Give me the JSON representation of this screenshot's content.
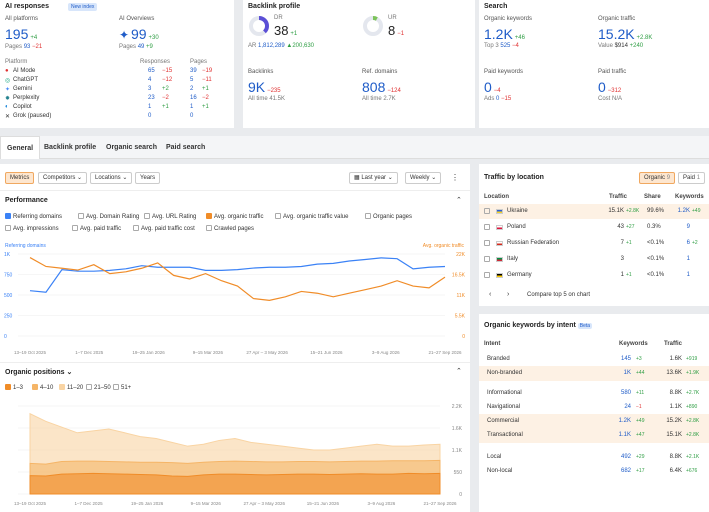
{
  "ai": {
    "title": "AI responses",
    "badge": "New index",
    "all_label": "All platforms",
    "all_value": "195",
    "all_delta": "+4",
    "pages_label": "Pages",
    "pages_value": "93",
    "pages_delta": "−21",
    "ov_label": "AI Overviews",
    "ov_value": "99",
    "ov_delta": "+30",
    "ov_pages_label": "Pages",
    "ov_pages_value": "49",
    "ov_pages_delta": "+9",
    "col_platform": "Platform",
    "col_resp": "Responses",
    "col_pages": "Pages",
    "rows": [
      {
        "name": "AI Mode",
        "r": "65",
        "rd": "−15",
        "p": "39",
        "pd": "−19"
      },
      {
        "name": "ChatGPT",
        "r": "4",
        "rd": "−12",
        "p": "5",
        "pd": "−11"
      },
      {
        "name": "Gemini",
        "r": "3",
        "rd": "+2",
        "p": "2",
        "pd": "+1"
      },
      {
        "name": "Perplexity",
        "r": "23",
        "rd": "−2",
        "p": "16",
        "pd": "−2"
      },
      {
        "name": "Copilot",
        "r": "1",
        "rd": "+1",
        "p": "1",
        "pd": "+1"
      },
      {
        "name": "Grok (paused)",
        "r": "0",
        "rd": "",
        "p": "0",
        "pd": ""
      }
    ]
  },
  "bl": {
    "title": "Backlink profile",
    "dr_label": "DR",
    "dr_value": "38",
    "dr_delta": "+1",
    "ur_label": "UR",
    "ur_value": "8",
    "ur_delta": "−1",
    "ar_label": "AR",
    "ar_value": "1,812,289",
    "ar_delta": "▲200,630",
    "bk_label": "Backlinks",
    "bk_value": "9K",
    "bk_delta": "−235",
    "bk_all": "All time 41.5K",
    "rd_label": "Ref. domains",
    "rd_value": "808",
    "rd_delta": "−124",
    "rd_all": "All time 2.7K"
  },
  "search": {
    "title": "Search",
    "ok_label": "Organic keywords",
    "ok_value": "1.2K",
    "ok_delta": "+46",
    "top3": "Top 3",
    "top3_v": "525",
    "top3_d": "−4",
    "ot_label": "Organic traffic",
    "ot_value": "15.2K",
    "ot_delta": "+2.8K",
    "val_label": "Value",
    "val_v": "$914",
    "val_d": "+240",
    "pk_label": "Paid keywords",
    "pk_value": "0",
    "pk_delta": "−4",
    "ads": "Ads",
    "ads_v": "0",
    "ads_d": "−15",
    "pt_label": "Paid traffic",
    "pt_value": "0",
    "pt_delta": "−312",
    "cost": "Cost N/A"
  },
  "tabs": [
    "General",
    "Backlink profile",
    "Organic search",
    "Paid search"
  ],
  "toolbar": {
    "b1": "Metrics",
    "b2": "Competitors",
    "b3": "Locations",
    "b4": "Years",
    "range": "Last year",
    "period": "Weekly"
  },
  "perf": {
    "title": "Performance",
    "checks": [
      {
        "l": "Referring domains",
        "on": true
      },
      {
        "l": "Avg. Domain Rating",
        "on": false
      },
      {
        "l": "Avg. URL Rating",
        "on": false
      },
      {
        "l": "Avg. organic traffic",
        "on": true
      },
      {
        "l": "Avg. organic traffic value",
        "on": false
      },
      {
        "l": "Organic pages",
        "on": false
      },
      {
        "l": "Avg. impressions",
        "on": false
      },
      {
        "l": "Avg. paid traffic",
        "on": false
      },
      {
        "l": "Avg. paid traffic cost",
        "on": false
      },
      {
        "l": "Crawled pages",
        "on": false
      }
    ],
    "left_axis_title": "Referring domains",
    "right_axis_title": "Avg. organic traffic"
  },
  "pos": {
    "title": "Organic positions",
    "checks": [
      {
        "l": "1–3",
        "on": true
      },
      {
        "l": "4–10",
        "on": true
      },
      {
        "l": "11–20",
        "on": true
      },
      {
        "l": "21–50",
        "on": false
      },
      {
        "l": "51+",
        "on": false
      }
    ]
  },
  "chart_data": [
    {
      "type": "line",
      "title": "Performance",
      "x": [
        "13–19 Oct 2025",
        "1–7 Dec 2025",
        "19–25 Jan 2026",
        "9–15 Mar 2026",
        "27 Apr – 3 May 2026",
        "15–21 Jun 2026",
        "3–9 Aug 2026",
        "21–27 Sep 2026"
      ],
      "yleft": {
        "ticks": [
          "0",
          "250",
          "500",
          "750",
          "1K"
        ],
        "range": [
          0,
          1050
        ]
      },
      "yright": {
        "ticks": [
          "0",
          "5.5K",
          "11K",
          "16.5K",
          "22K"
        ],
        "range": [
          0,
          23000
        ]
      },
      "series": [
        {
          "name": "Referring domains",
          "axis": "left",
          "color": "#3b82f6",
          "values": [
            580,
            560,
            850,
            830,
            830,
            840,
            860,
            900,
            880,
            880,
            880,
            840,
            840,
            850,
            870,
            880,
            880,
            890,
            920,
            930,
            960,
            980,
            1000,
            990,
            860,
            880,
            890
          ]
        },
        {
          "name": "Avg. organic traffic",
          "axis": "right",
          "color": "#f08c28",
          "values": [
            22000,
            19500,
            19000,
            18500,
            20000,
            17500,
            18000,
            19000,
            20500,
            17000,
            16000,
            17500,
            15500,
            14000,
            10500,
            10000,
            11000,
            12500,
            12000,
            11000,
            12000,
            13000,
            14000,
            15500,
            14000,
            13500,
            16500
          ]
        }
      ]
    },
    {
      "type": "area",
      "title": "Organic positions",
      "x": [
        "13–19 Oct 2025",
        "1–7 Dec 2025",
        "19–25 Jan 2026",
        "9–15 Mar 2026",
        "27 Apr – 3 May 2026",
        "15–21 Jun 2026",
        "3–9 Aug 2026",
        "21–27 Sep 2026"
      ],
      "yticks": [
        "0",
        "550",
        "1.1K",
        "1.6K",
        "2.2K"
      ],
      "range": [
        0,
        2300
      ],
      "series": [
        {
          "name": "1–3",
          "color": "#f08c28",
          "values": [
            480,
            470,
            520,
            530,
            540,
            530,
            520,
            510,
            500,
            470,
            460,
            500,
            520,
            520,
            510,
            500,
            510,
            520,
            520,
            510,
            520,
            530,
            520,
            520,
            540,
            530,
            540
          ]
        },
        {
          "name": "4–10",
          "color": "#f5b567",
          "values": [
            800,
            780,
            850,
            860,
            860,
            850,
            840,
            830,
            830,
            820,
            800,
            830,
            850,
            860,
            850,
            840,
            840,
            850,
            850,
            840,
            850,
            860,
            860,
            870,
            870,
            870,
            880
          ]
        },
        {
          "name": "11–20",
          "color": "#f9d4a3",
          "values": [
            2100,
            1900,
            1750,
            1600,
            1650,
            1700,
            1600,
            1500,
            1450,
            1350,
            1250,
            1300,
            1400,
            1450,
            1350,
            1300,
            1250,
            1200,
            1150,
            1150,
            1200,
            1250,
            1300,
            1250,
            1250,
            1280,
            1300
          ]
        }
      ]
    }
  ],
  "loc": {
    "title": "Traffic by location",
    "btn_org": "Organic",
    "btn_org_n": "9",
    "btn_paid": "Paid",
    "btn_paid_n": "1",
    "h_loc": "Location",
    "h_tr": "Traffic",
    "h_share": "Share",
    "h_kw": "Keywords",
    "rows": [
      {
        "name": "Ukraine",
        "tr": "15.1K",
        "trd": "+2.8K",
        "share": "99.6%",
        "kw": "1.2K",
        "kwd": "+49",
        "f1": "#2b5fd9",
        "f2": "#f5d327"
      },
      {
        "name": "Poland",
        "tr": "43",
        "trd": "+27",
        "share": "0.3%",
        "kw": "9",
        "kwd": "",
        "f1": "#ffffff",
        "f2": "#dc143c"
      },
      {
        "name": "Russian Federation",
        "tr": "7",
        "trd": "+1",
        "share": "<0.1%",
        "kw": "6",
        "kwd": "+2",
        "f1": "#ffffff",
        "f2": "#d52b1e"
      },
      {
        "name": "Italy",
        "tr": "3",
        "trd": "",
        "share": "<0.1%",
        "kw": "1",
        "kwd": "",
        "f1": "#009246",
        "f2": "#ce2b37"
      },
      {
        "name": "Germany",
        "tr": "1",
        "trd": "+1",
        "share": "<0.1%",
        "kw": "1",
        "kwd": "",
        "f1": "#000000",
        "f2": "#ffce00"
      }
    ],
    "compare": "Compare top 5 on chart"
  },
  "intent": {
    "title": "Organic keywords by intent",
    "badge": "Beta",
    "h_int": "Intent",
    "h_kw": "Keywords",
    "h_tr": "Traffic",
    "rows": [
      {
        "name": "Branded",
        "kw": "145",
        "kwd": "+3",
        "tr": "1.6K",
        "trd": "+919"
      },
      {
        "name": "Non-branded",
        "kw": "1K",
        "kwd": "+44",
        "tr": "13.6K",
        "trd": "+1.9K"
      },
      {
        "name": "Informational",
        "kw": "580",
        "kwd": "+11",
        "tr": "8.8K",
        "trd": "+2.7K"
      },
      {
        "name": "Navigational",
        "kw": "24",
        "kwd": "−1",
        "tr": "1.1K",
        "trd": "+890"
      },
      {
        "name": "Commercial",
        "kw": "1.2K",
        "kwd": "+49",
        "tr": "15.2K",
        "trd": "+2.8K"
      },
      {
        "name": "Transactional",
        "kw": "1.1K",
        "kwd": "+47",
        "tr": "15.1K",
        "trd": "+2.8K"
      },
      {
        "name": "Local",
        "kw": "492",
        "kwd": "+29",
        "tr": "8.8K",
        "trd": "+2.1K"
      },
      {
        "name": "Non-local",
        "kw": "682",
        "kwd": "+17",
        "tr": "6.4K",
        "trd": "+676"
      }
    ]
  }
}
